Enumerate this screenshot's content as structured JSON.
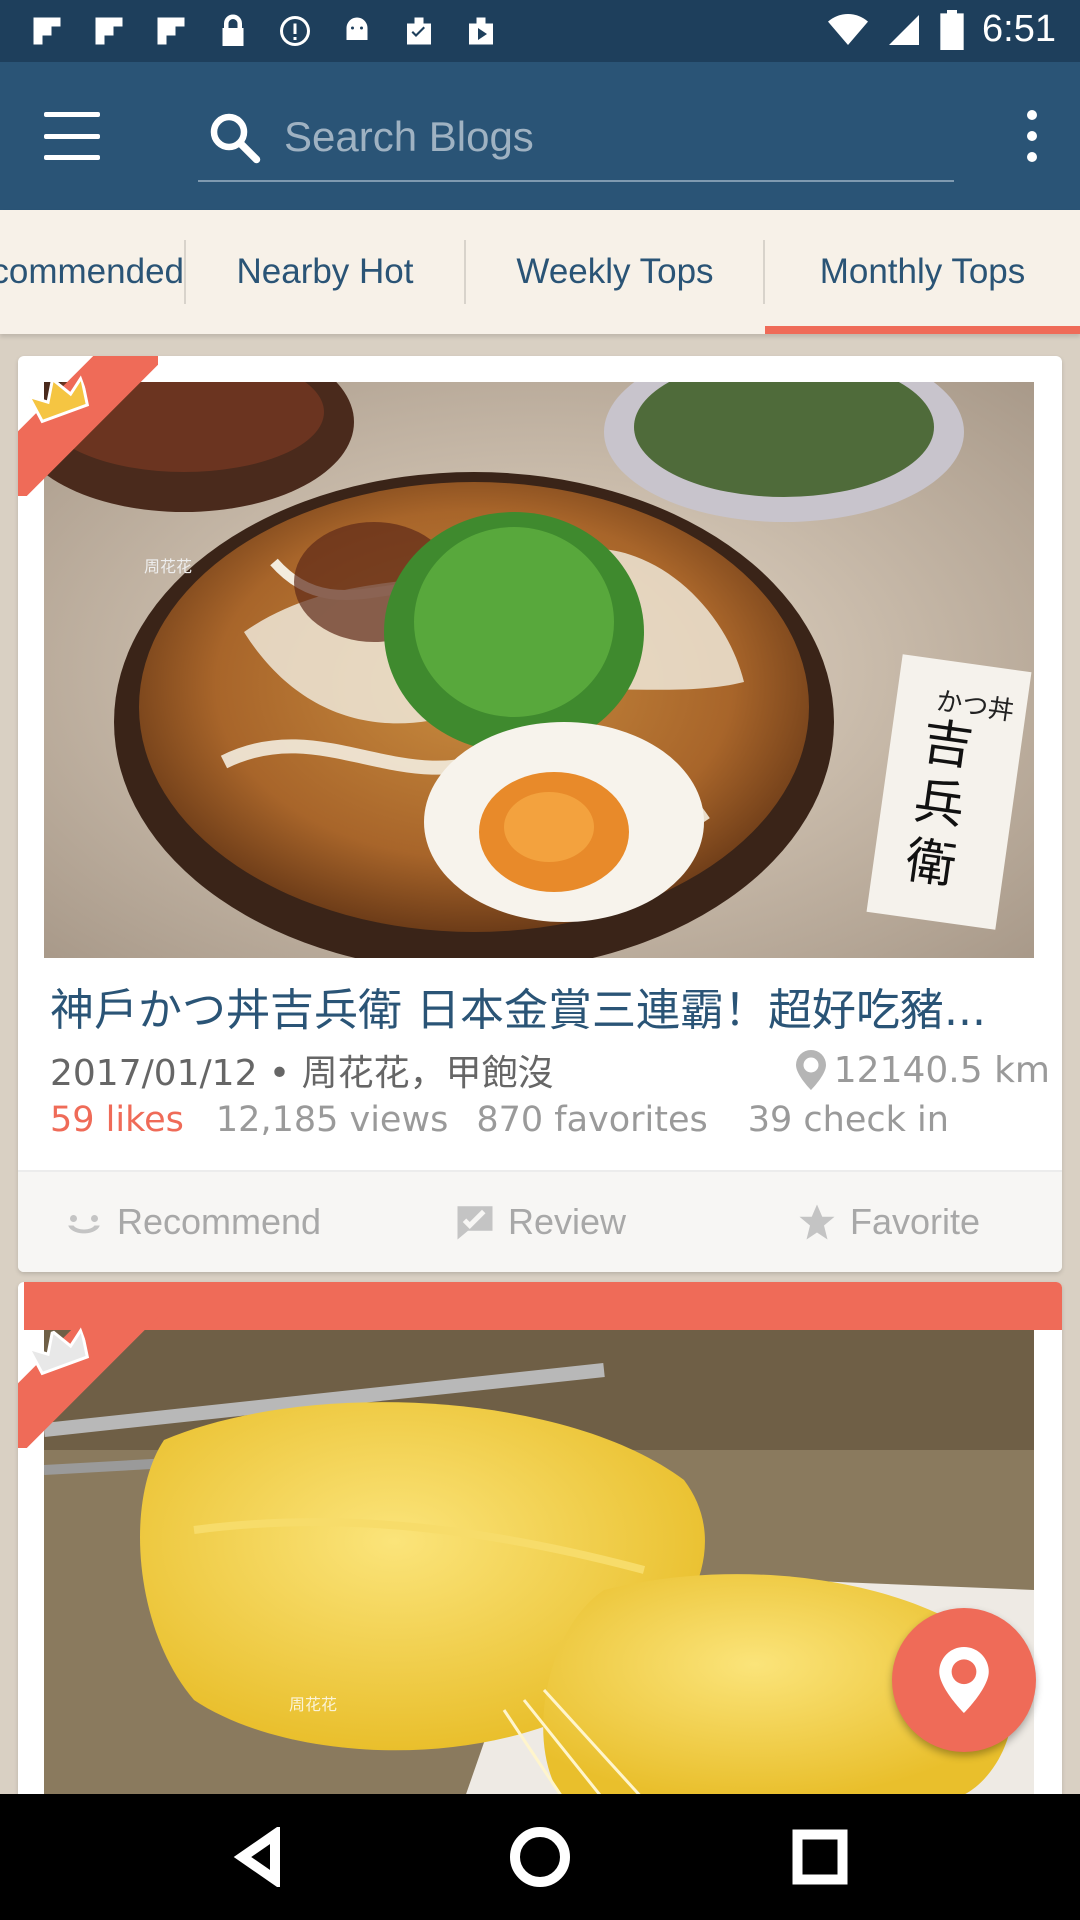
{
  "status_bar": {
    "time": "6:51"
  },
  "search": {
    "placeholder": "Search Blogs"
  },
  "tabs": [
    {
      "label": "Recommended"
    },
    {
      "label": "Nearby Hot"
    },
    {
      "label": "Weekly Tops"
    },
    {
      "label": "Monthly Tops",
      "active": true
    }
  ],
  "posts": [
    {
      "title": "神戶かつ丼吉兵衛 日本金賞三連霸！超好吃豬...",
      "date_author": "2017/01/12 • 周花花，甲飽沒",
      "distance": "12140.5 km",
      "likes": "59 likes",
      "views": "12,185 views",
      "favorites": "870 favorites",
      "check_ins": "39 check in",
      "photo_watermark": "周花花",
      "photo_sign_text": "かつ丼 吉兵衛"
    },
    {
      "photo_watermark": "周花花"
    }
  ],
  "actions": {
    "recommend": "Recommend",
    "review": "Review",
    "favorite": "Favorite"
  },
  "colors": {
    "primary": "#2a5476",
    "status_bar": "#1e3f5c",
    "accent": "#ef6b58",
    "background": "#d9d0c3"
  },
  "icons": {
    "menu": "hamburger-menu-icon",
    "search": "search-icon",
    "overflow": "overflow-menu-icon",
    "crown": "crown-icon",
    "location_pin": "location-pin-icon"
  }
}
